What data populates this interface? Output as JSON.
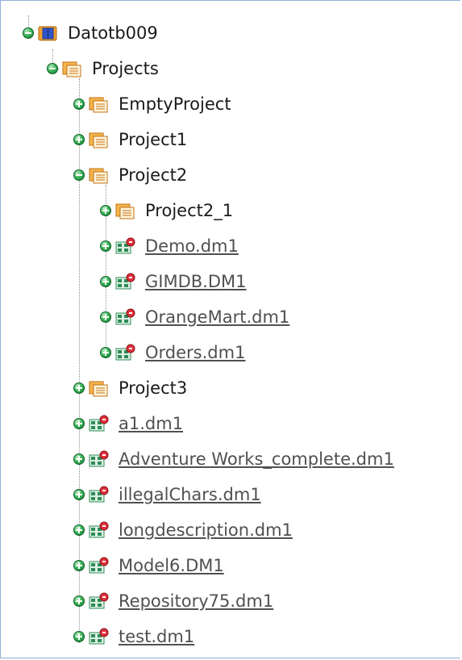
{
  "tree": {
    "root": {
      "label": "Datotb009",
      "icon": "database-icon",
      "state": "expanded"
    },
    "projects": {
      "label": "Projects",
      "icon": "folder-icon",
      "state": "expanded"
    },
    "items": [
      {
        "label": "EmptyProject",
        "icon": "project-icon",
        "state": "collapsed",
        "link": false
      },
      {
        "label": "Project1",
        "icon": "project-icon",
        "state": "collapsed",
        "link": false
      },
      {
        "label": "Project2",
        "icon": "project-icon",
        "state": "expanded",
        "link": false
      },
      {
        "label": "Project2_1",
        "icon": "project-icon",
        "state": "collapsed",
        "link": false
      },
      {
        "label": "Demo.dm1",
        "icon": "model-icon",
        "state": "collapsed",
        "link": true
      },
      {
        "label": "GIMDB.DM1",
        "icon": "model-icon",
        "state": "collapsed",
        "link": true
      },
      {
        "label": "OrangeMart.dm1",
        "icon": "model-icon",
        "state": "collapsed",
        "link": true
      },
      {
        "label": "Orders.dm1",
        "icon": "model-icon",
        "state": "collapsed",
        "link": true
      },
      {
        "label": "Project3",
        "icon": "project-icon",
        "state": "collapsed",
        "link": false
      },
      {
        "label": "a1.dm1",
        "icon": "model-icon",
        "state": "collapsed",
        "link": true
      },
      {
        "label": "Adventure Works_complete.dm1",
        "icon": "model-icon",
        "state": "collapsed",
        "link": true
      },
      {
        "label": "illegalChars.dm1",
        "icon": "model-icon",
        "state": "collapsed",
        "link": true
      },
      {
        "label": "longdescription.dm1",
        "icon": "model-icon",
        "state": "collapsed",
        "link": true
      },
      {
        "label": "Model6.DM1",
        "icon": "model-icon",
        "state": "collapsed",
        "link": true
      },
      {
        "label": "Repository75.dm1",
        "icon": "model-icon",
        "state": "collapsed",
        "link": true
      },
      {
        "label": "test.dm1",
        "icon": "model-icon",
        "state": "collapsed",
        "link": true
      }
    ]
  },
  "colors": {
    "panel_border": "#8fb2d8",
    "link_text": "#505050",
    "expander_green": "#3fb75a",
    "folder_orange": "#f0a030",
    "database_blue": "#2f55c8",
    "model_green": "#2e8b57",
    "model_badge_red": "#e0303a"
  }
}
